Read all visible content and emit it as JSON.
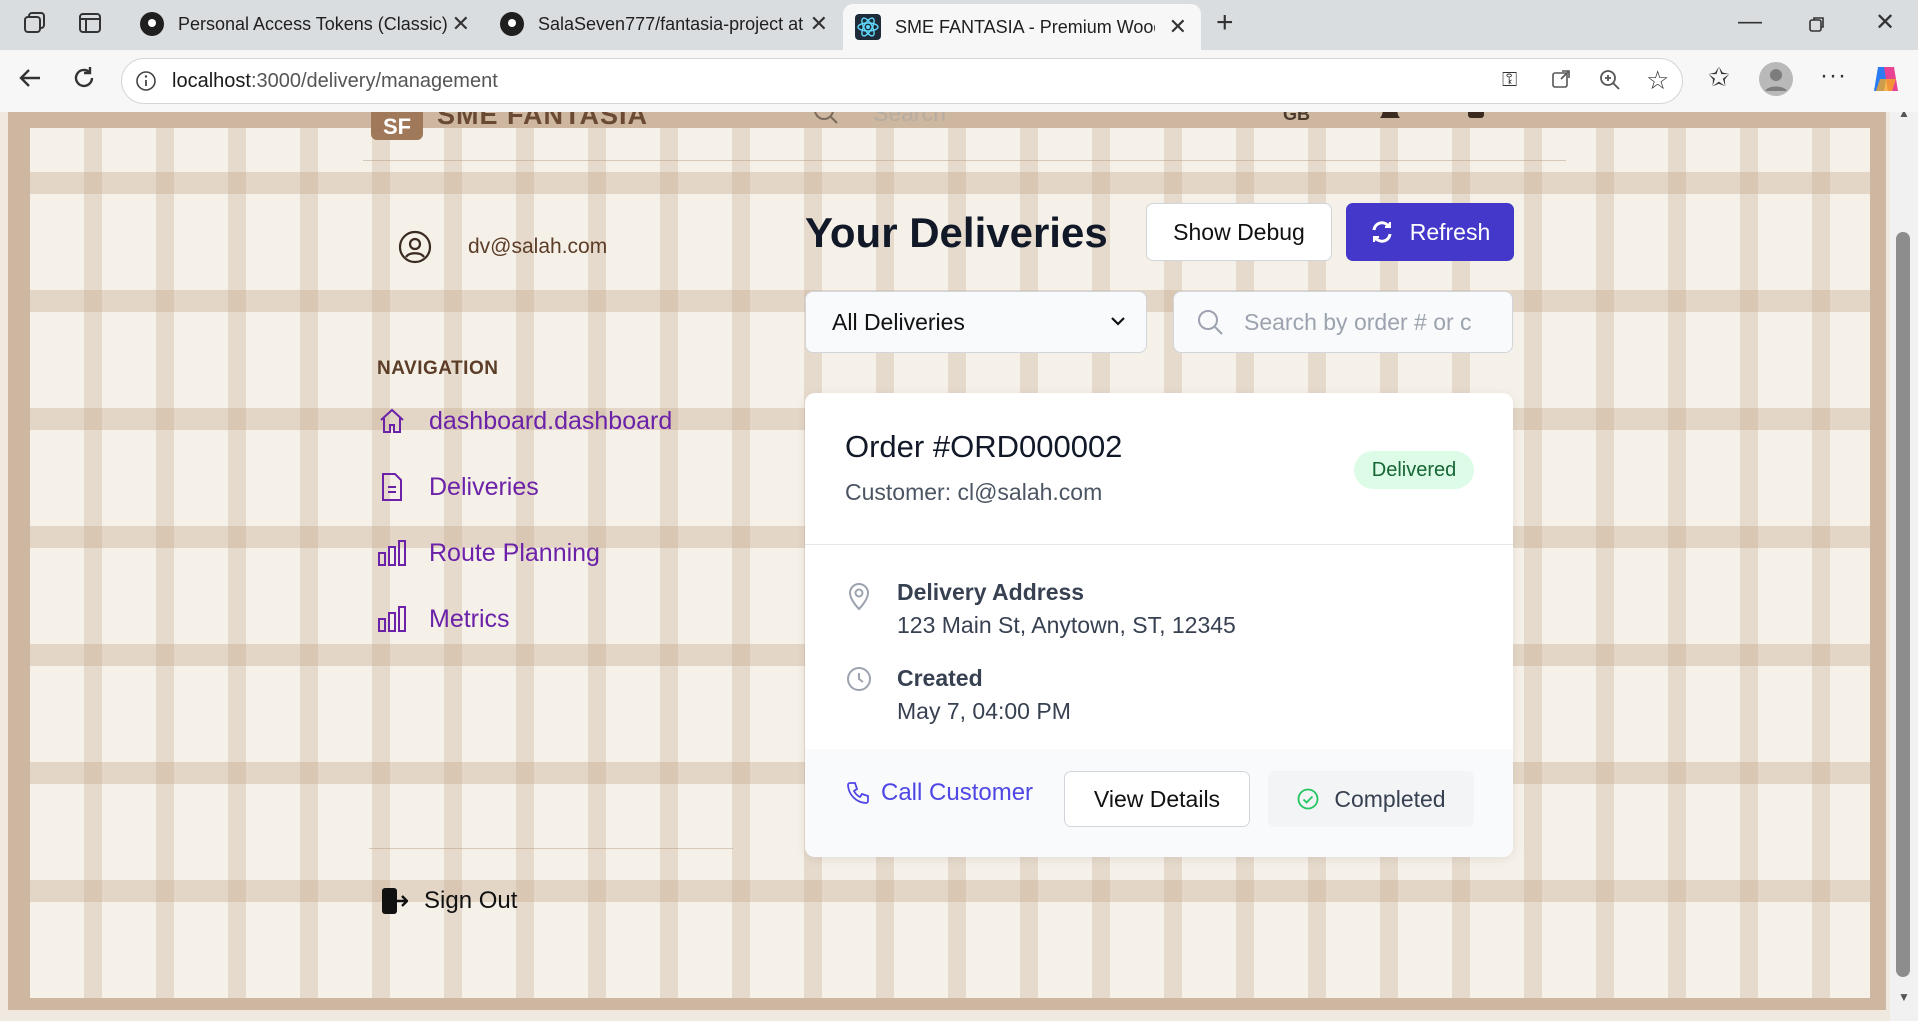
{
  "browser": {
    "tabs": [
      {
        "title": "Personal Access Tokens (Classic)"
      },
      {
        "title": "SalaSeven777/fantasia-project at"
      },
      {
        "title": "SME FANTASIA - Premium Wood"
      }
    ],
    "url_host": "localhost",
    "url_rest": ":3000/delivery/management"
  },
  "header": {
    "brand": "SME FANTASIA",
    "logo_text": "SF",
    "search_placeholder": "Search",
    "lang": "GB"
  },
  "sidebar": {
    "user_email": "dv@salah.com",
    "nav_title": "NAVIGATION",
    "items": [
      {
        "label": "dashboard.dashboard",
        "icon": "home-icon"
      },
      {
        "label": "Deliveries",
        "icon": "document-icon"
      },
      {
        "label": "Route Planning",
        "icon": "bar-chart-icon"
      },
      {
        "label": "Metrics",
        "icon": "bar-chart-icon"
      }
    ],
    "sign_out": "Sign Out"
  },
  "main": {
    "title": "Your Deliveries",
    "show_debug": "Show Debug",
    "refresh": "Refresh",
    "filter_selected": "All Deliveries",
    "search_placeholder": "Search by order # or c"
  },
  "delivery": {
    "order": "Order #ORD000002",
    "customer": "Customer: cl@salah.com",
    "status": "Delivered",
    "address_label": "Delivery Address",
    "address": "123 Main St, Anytown, ST, 12345",
    "created_label": "Created",
    "created": "May 7, 04:00 PM",
    "call": "Call Customer",
    "view": "View Details",
    "completed": "Completed"
  },
  "colors": {
    "accent": "#4338ca",
    "nav_link": "#6b21a8",
    "delivered_bg": "#dcfce7",
    "frame": "#cdb7a0"
  }
}
